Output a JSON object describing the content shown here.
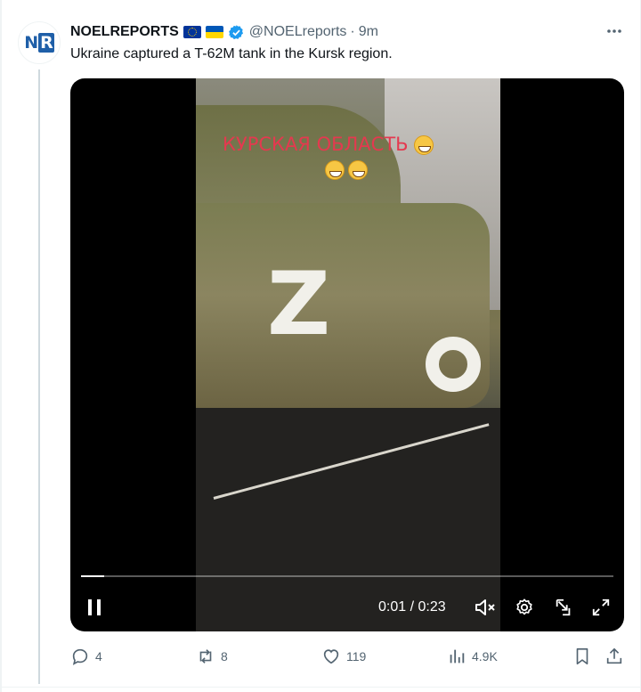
{
  "tweet": {
    "display_name": "NOELREPORTS",
    "flags": [
      "eu-flag",
      "ukraine-flag"
    ],
    "verified_icon": "verified-badge-icon",
    "handle": "@NOELreports",
    "separator": "·",
    "time": "9m",
    "more_icon": "more-icon",
    "text": "Ukraine captured a T-62M tank in the Kursk region.",
    "avatar": {
      "logo_left": "N",
      "logo_right": "R"
    }
  },
  "video": {
    "overlay_caption": "КУРСКАЯ ОБЛАСТЬ",
    "markings": {
      "letter": "Z"
    },
    "time_readout": "0:01 / 0:23",
    "progress": 0.043,
    "controls": [
      "pause-icon",
      "mute-icon",
      "settings-icon",
      "picture-in-picture-icon",
      "fullscreen-icon"
    ]
  },
  "actions": {
    "reply_count": "4",
    "repost_count": "8",
    "like_count": "119",
    "views_count": "4.9K"
  },
  "colors": {
    "accent": "#1d9bf0",
    "secondary_text": "#536471",
    "primary_text": "#0f1419",
    "overlay_red": "#e4394f"
  }
}
